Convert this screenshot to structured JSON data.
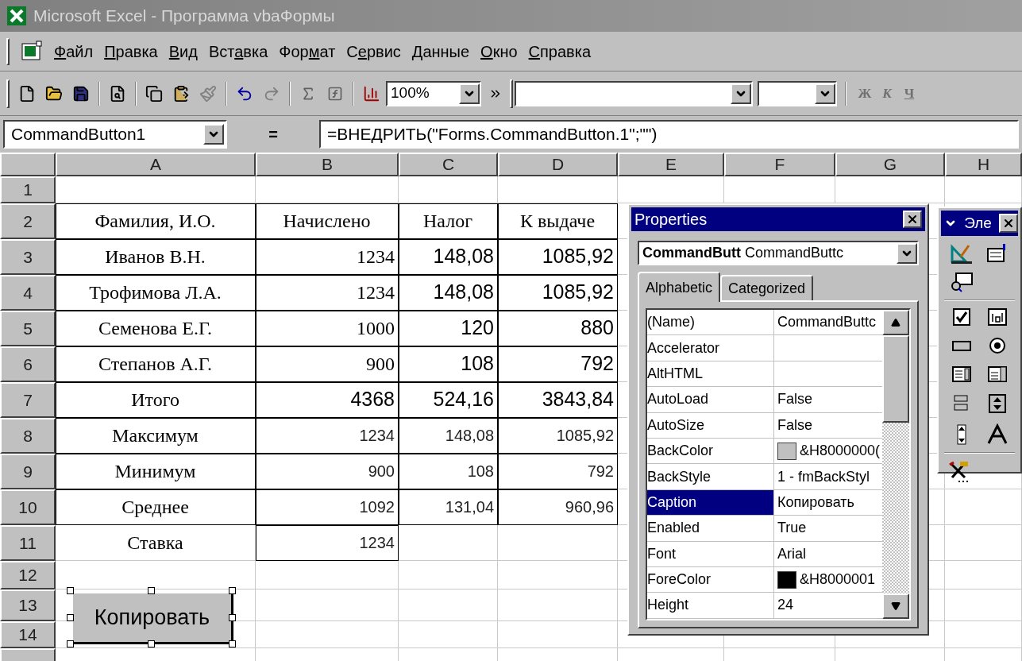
{
  "window": {
    "title": "Microsoft Excel - Программа vbaФормы"
  },
  "menu": [
    {
      "key": "Ф",
      "after": "айл"
    },
    {
      "key": "П",
      "after": "равка"
    },
    {
      "key": "В",
      "after": "ид"
    },
    {
      "before": "Вст",
      "key": "а",
      "after": "вка"
    },
    {
      "before": "Фор",
      "key": "м",
      "after": "ат"
    },
    {
      "before": "С",
      "key": "е",
      "after": "рвис"
    },
    {
      "key": "Д",
      "after": "анные"
    },
    {
      "key": "О",
      "after": "кно"
    },
    {
      "key": "С",
      "after": "правка"
    }
  ],
  "toolbar": {
    "zoom": "100%",
    "format_buttons": [
      "Ж",
      "К",
      "Ч"
    ]
  },
  "formula_bar": {
    "name_box": "CommandButton1",
    "equals": "=",
    "formula": "=ВНЕДРИТЬ(\"Forms.CommandButton.1\";\"\")"
  },
  "sheet": {
    "columns": [
      "A",
      "B",
      "C",
      "D",
      "E",
      "F",
      "G",
      "H"
    ],
    "rows": [
      {
        "label": "1",
        "cells": []
      },
      {
        "label": "2",
        "cells": [
          {
            "text": "Фамилия, И.О.",
            "kind": "label",
            "boxed": true
          },
          {
            "text": "Начислено",
            "kind": "label",
            "boxed": true
          },
          {
            "text": "Налог",
            "kind": "label",
            "boxed": true
          },
          {
            "text": "К выдаче",
            "kind": "label",
            "boxed": true
          }
        ]
      },
      {
        "label": "3",
        "cells": [
          {
            "text": "Иванов В.Н.",
            "kind": "label",
            "boxed": true
          },
          {
            "text": "1234",
            "kind": "serif_number",
            "boxed": true
          },
          {
            "text": "148,08",
            "kind": "big_number",
            "boxed": true
          },
          {
            "text": "1085,92",
            "kind": "big_number",
            "boxed": true
          }
        ]
      },
      {
        "label": "4",
        "cells": [
          {
            "text": "Трофимова Л.А.",
            "kind": "label",
            "boxed": true
          },
          {
            "text": "1234",
            "kind": "serif_number",
            "boxed": true
          },
          {
            "text": "148,08",
            "kind": "big_number",
            "boxed": true
          },
          {
            "text": "1085,92",
            "kind": "big_number",
            "boxed": true
          }
        ]
      },
      {
        "label": "5",
        "cells": [
          {
            "text": "Семенова Е.Г.",
            "kind": "label",
            "boxed": true
          },
          {
            "text": "1000",
            "kind": "serif_number",
            "boxed": true
          },
          {
            "text": "120",
            "kind": "big_number",
            "boxed": true
          },
          {
            "text": "880",
            "kind": "big_number",
            "boxed": true
          }
        ]
      },
      {
        "label": "6",
        "cells": [
          {
            "text": "Степанов А.Г.",
            "kind": "label",
            "boxed": true
          },
          {
            "text": "900",
            "kind": "serif_number",
            "boxed": true
          },
          {
            "text": "108",
            "kind": "big_number",
            "boxed": true
          },
          {
            "text": "792",
            "kind": "big_number",
            "boxed": true
          }
        ]
      },
      {
        "label": "7",
        "cells": [
          {
            "text": "Итого",
            "kind": "label",
            "boxed": true
          },
          {
            "text": "4368",
            "kind": "big_number",
            "boxed": true
          },
          {
            "text": "524,16",
            "kind": "big_number",
            "boxed": true
          },
          {
            "text": "3843,84",
            "kind": "big_number",
            "boxed": true
          }
        ]
      },
      {
        "label": "8",
        "cells": [
          {
            "text": "Максимум",
            "kind": "label",
            "boxed": true
          },
          {
            "text": "1234",
            "kind": "number",
            "boxed": true
          },
          {
            "text": "148,08",
            "kind": "number",
            "boxed": true
          },
          {
            "text": "1085,92",
            "kind": "number",
            "boxed": true
          }
        ]
      },
      {
        "label": "9",
        "cells": [
          {
            "text": "Минимум",
            "kind": "label",
            "boxed": true
          },
          {
            "text": "900",
            "kind": "number",
            "boxed": true
          },
          {
            "text": "108",
            "kind": "number",
            "boxed": true
          },
          {
            "text": "792",
            "kind": "number",
            "boxed": true
          }
        ]
      },
      {
        "label": "10",
        "cells": [
          {
            "text": "Среднее",
            "kind": "label",
            "boxed": true
          },
          {
            "text": "1092",
            "kind": "number",
            "boxed": true
          },
          {
            "text": "131,04",
            "kind": "number",
            "boxed": true
          },
          {
            "text": "960,96",
            "kind": "number",
            "boxed": true
          }
        ]
      },
      {
        "label": "11",
        "cells": [
          {
            "text": "Ставка",
            "kind": "label",
            "boxed": false
          },
          {
            "text": "1234",
            "kind": "number",
            "boxed": true
          }
        ]
      },
      {
        "label": "12",
        "cells": []
      },
      {
        "label": "13",
        "cells": []
      },
      {
        "label": "14",
        "cells": []
      }
    ],
    "embedded_button": {
      "caption": "Копировать",
      "selected": true
    }
  },
  "properties": {
    "title": "Properties",
    "object_name": "CommandButt",
    "object_type": "CommandButtc",
    "tabs": [
      {
        "label": "Alphabetic",
        "selected": true
      },
      {
        "label": "Categorized",
        "selected": false
      }
    ],
    "rows": [
      {
        "name": "(Name)",
        "value": "CommandButtc",
        "selected": false
      },
      {
        "name": "Accelerator",
        "selected": false
      },
      {
        "name": "AltHTML",
        "selected": false
      },
      {
        "name": "AutoLoad",
        "value": "False",
        "selected": false
      },
      {
        "name": "AutoSize",
        "value": "False",
        "selected": false
      },
      {
        "name": "BackColor",
        "value": "&H8000000(",
        "color": "#c0c0c0",
        "selected": false
      },
      {
        "name": "BackStyle",
        "value": "1 - fmBackStyl",
        "selected": false
      },
      {
        "name": "Caption",
        "value": "Копировать",
        "selected": true
      },
      {
        "name": "Enabled",
        "value": "True",
        "selected": false
      },
      {
        "name": "Font",
        "value": "Arial",
        "selected": false
      },
      {
        "name": "ForeColor",
        "value": "&H8000001",
        "color": "#000000",
        "selected": false
      },
      {
        "name": "Height",
        "value": "24",
        "selected": false
      }
    ]
  },
  "toolbox": {
    "title": "Эле"
  }
}
